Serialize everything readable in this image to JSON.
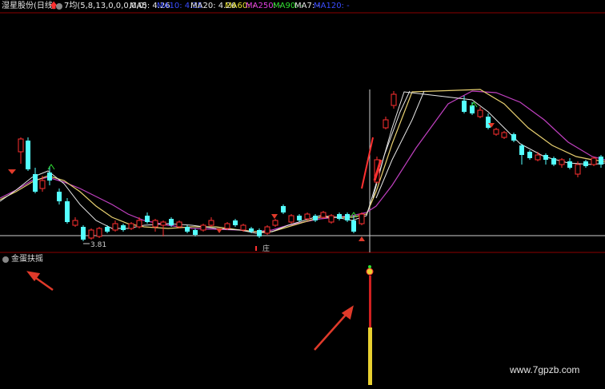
{
  "header": {
    "stock_title": "湿星股份(日线)",
    "ma_config": "7均(5,8,13,0,0,0,0,0)",
    "ma_values": [
      {
        "label": "MA5: 4.26",
        "color": "#e6e6e6"
      },
      {
        "label": "MA10: 4.35",
        "color": "#3a4cff"
      },
      {
        "label": "MA20: 4.26",
        "color": "#e6e6e6"
      },
      {
        "label": "MA60: -",
        "color": "#e8e030"
      },
      {
        "label": "MA250: -",
        "color": "#e040e0"
      },
      {
        "label": "MA90: -",
        "color": "#30e030"
      },
      {
        "label": "MA7: -",
        "color": "#e6e6e6"
      },
      {
        "label": "MA120: -",
        "color": "#3a4cff"
      }
    ]
  },
  "chart": {
    "low_price_label": "3.81",
    "marker_label": "庄"
  },
  "indicator": {
    "name": "金蛋扶摇"
  },
  "watermark": "www.7gpzb.com",
  "colors": {
    "up": "#ff3030",
    "down": "#54ffff",
    "ma_short": "#e6e6e6",
    "ma_mid": "#e8d070",
    "ma_long": "#c040c0",
    "arrow": "#e03a2a"
  }
}
